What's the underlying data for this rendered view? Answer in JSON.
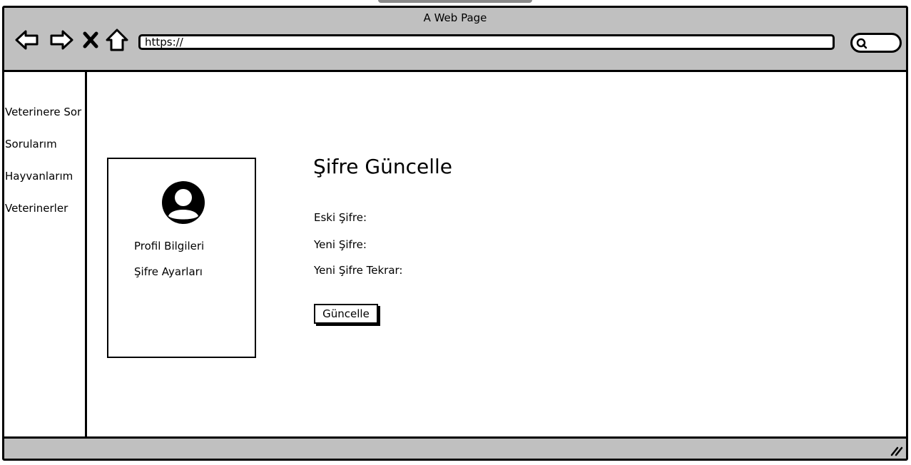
{
  "window": {
    "title": "A Web Page"
  },
  "toolbar": {
    "back_icon": "arrow-left-icon",
    "forward_icon": "arrow-right-icon",
    "stop_icon": "close-icon",
    "home_icon": "home-icon",
    "url": "https://",
    "search_icon": "search-icon"
  },
  "sidebar": {
    "items": [
      {
        "label": "Veterinere Sor"
      },
      {
        "label": "Sorularım"
      },
      {
        "label": "Hayvanlarım"
      },
      {
        "label": "Veterinerler"
      }
    ]
  },
  "profile_card": {
    "avatar_icon": "user-avatar-icon",
    "links": [
      {
        "label": "Profil Bilgileri"
      },
      {
        "label": "Şifre Ayarları"
      }
    ]
  },
  "form": {
    "title": "Şifre Güncelle",
    "fields": [
      {
        "label": "Eski Şifre:",
        "value": ""
      },
      {
        "label": "Yeni Şifre:",
        "value": ""
      },
      {
        "label": "Yeni Şifre Tekrar:",
        "value": ""
      }
    ],
    "submit_label": "Güncelle"
  },
  "statusbar": {
    "resize_icon": "resize-grip-icon"
  },
  "colors": {
    "chrome": "#c0c0c0",
    "border": "#000000",
    "background": "#ffffff"
  }
}
